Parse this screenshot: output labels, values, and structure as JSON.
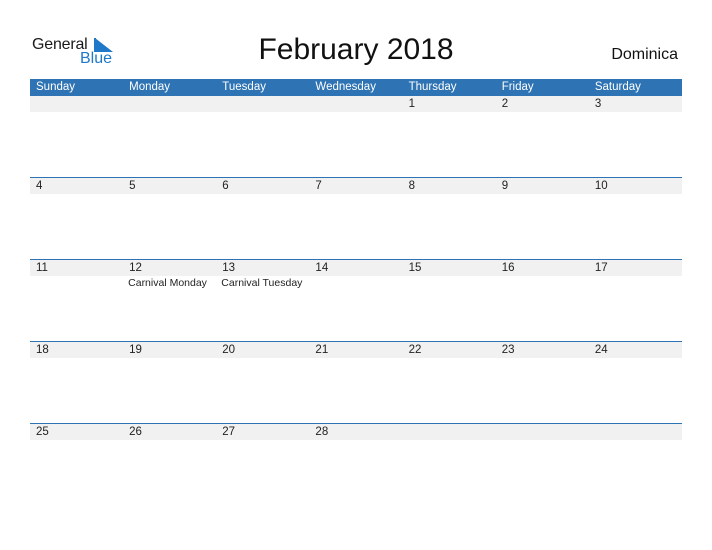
{
  "logo": {
    "line1": "General",
    "line2": "Blue"
  },
  "title": "February 2018",
  "country": "Dominica",
  "colors": {
    "header": "#2e73b3",
    "strip": "#f1f1f1",
    "logo_blue": "#1f78c8"
  },
  "days": [
    "Sunday",
    "Monday",
    "Tuesday",
    "Wednesday",
    "Thursday",
    "Friday",
    "Saturday"
  ],
  "weeks": [
    {
      "dates": [
        "",
        "",
        "",
        "",
        "1",
        "2",
        "3"
      ],
      "events": [
        "",
        "",
        "",
        "",
        "",
        "",
        ""
      ]
    },
    {
      "dates": [
        "4",
        "5",
        "6",
        "7",
        "8",
        "9",
        "10"
      ],
      "events": [
        "",
        "",
        "",
        "",
        "",
        "",
        ""
      ]
    },
    {
      "dates": [
        "11",
        "12",
        "13",
        "14",
        "15",
        "16",
        "17"
      ],
      "events": [
        "",
        "Carnival Monday",
        "Carnival Tuesday",
        "",
        "",
        "",
        ""
      ]
    },
    {
      "dates": [
        "18",
        "19",
        "20",
        "21",
        "22",
        "23",
        "24"
      ],
      "events": [
        "",
        "",
        "",
        "",
        "",
        "",
        ""
      ]
    },
    {
      "dates": [
        "25",
        "26",
        "27",
        "28",
        "",
        "",
        ""
      ],
      "events": [
        "",
        "",
        "",
        "",
        "",
        "",
        ""
      ]
    }
  ]
}
